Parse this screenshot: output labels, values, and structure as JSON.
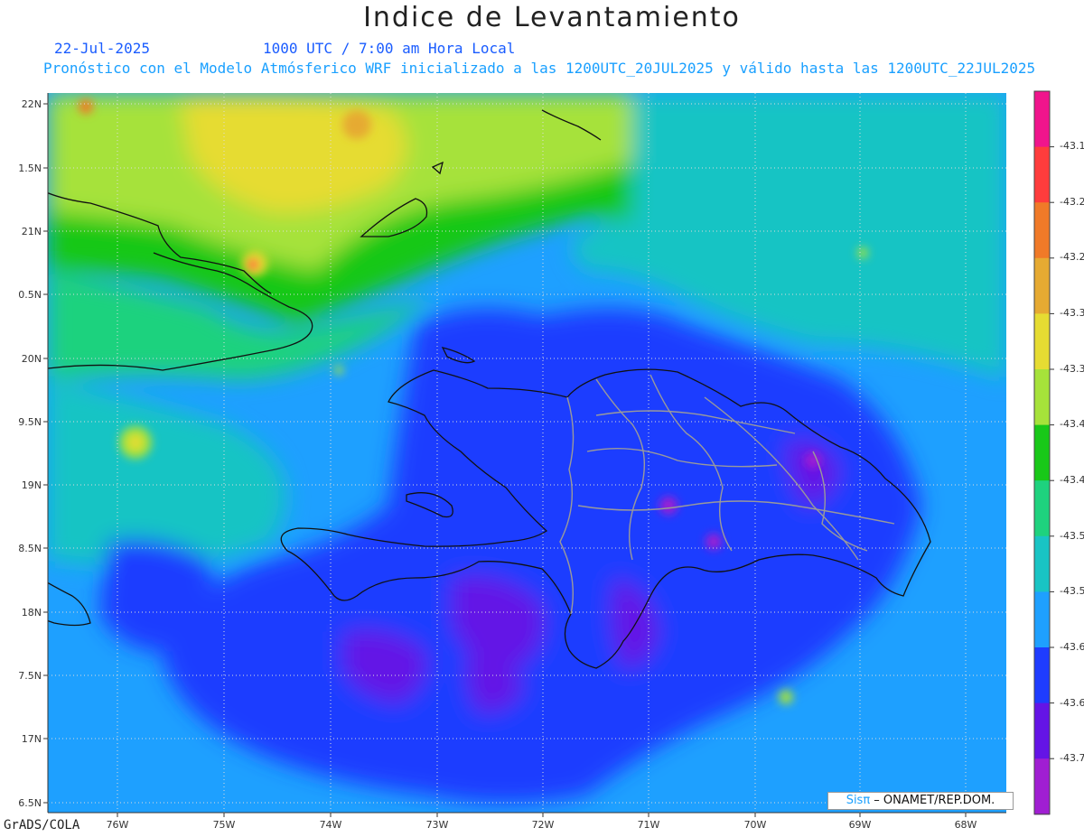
{
  "title": "Indice de Levantamiento",
  "date_text": "22-Jul-2025",
  "time_text": "1000 UTC / 7:00 am Hora Local",
  "forecast_text": "Pronóstico con el Modelo Atmósferico WRF inicializado a las 1200UTC_20JUL2025 y válido hasta las  1200UTC_22JUL2025",
  "footer_left": "GrADS/COLA",
  "credit": {
    "brand": "Sisπ",
    "org": " – ONAMET/REP.DOM."
  },
  "lat_labels": [
    "22N",
    "1.5N",
    "21N",
    "0.5N",
    "20N",
    "9.5N",
    "19N",
    "8.5N",
    "18N",
    "7.5N",
    "17N",
    "6.5N"
  ],
  "lon_labels": [
    "76W",
    "75W",
    "74W",
    "73W",
    "72W",
    "71W",
    "70W",
    "69W",
    "68W"
  ],
  "colorbar": {
    "labels": [
      "-43.1",
      "-43.2",
      "-43.2",
      "-43.3",
      "-43.3",
      "-43.4",
      "-43.4",
      "-43.5",
      "-43.5",
      "-43.6",
      "-43.6",
      "-43.7"
    ],
    "colors": [
      "#f0158c",
      "#ff3c3c",
      "#f07a28",
      "#e6aa32",
      "#e6dc32",
      "#a6e23a",
      "#18c818",
      "#1ed27e",
      "#19c4c4",
      "#1ea0ff",
      "#1e3cff",
      "#6414e6",
      "#a01ed2"
    ]
  }
}
